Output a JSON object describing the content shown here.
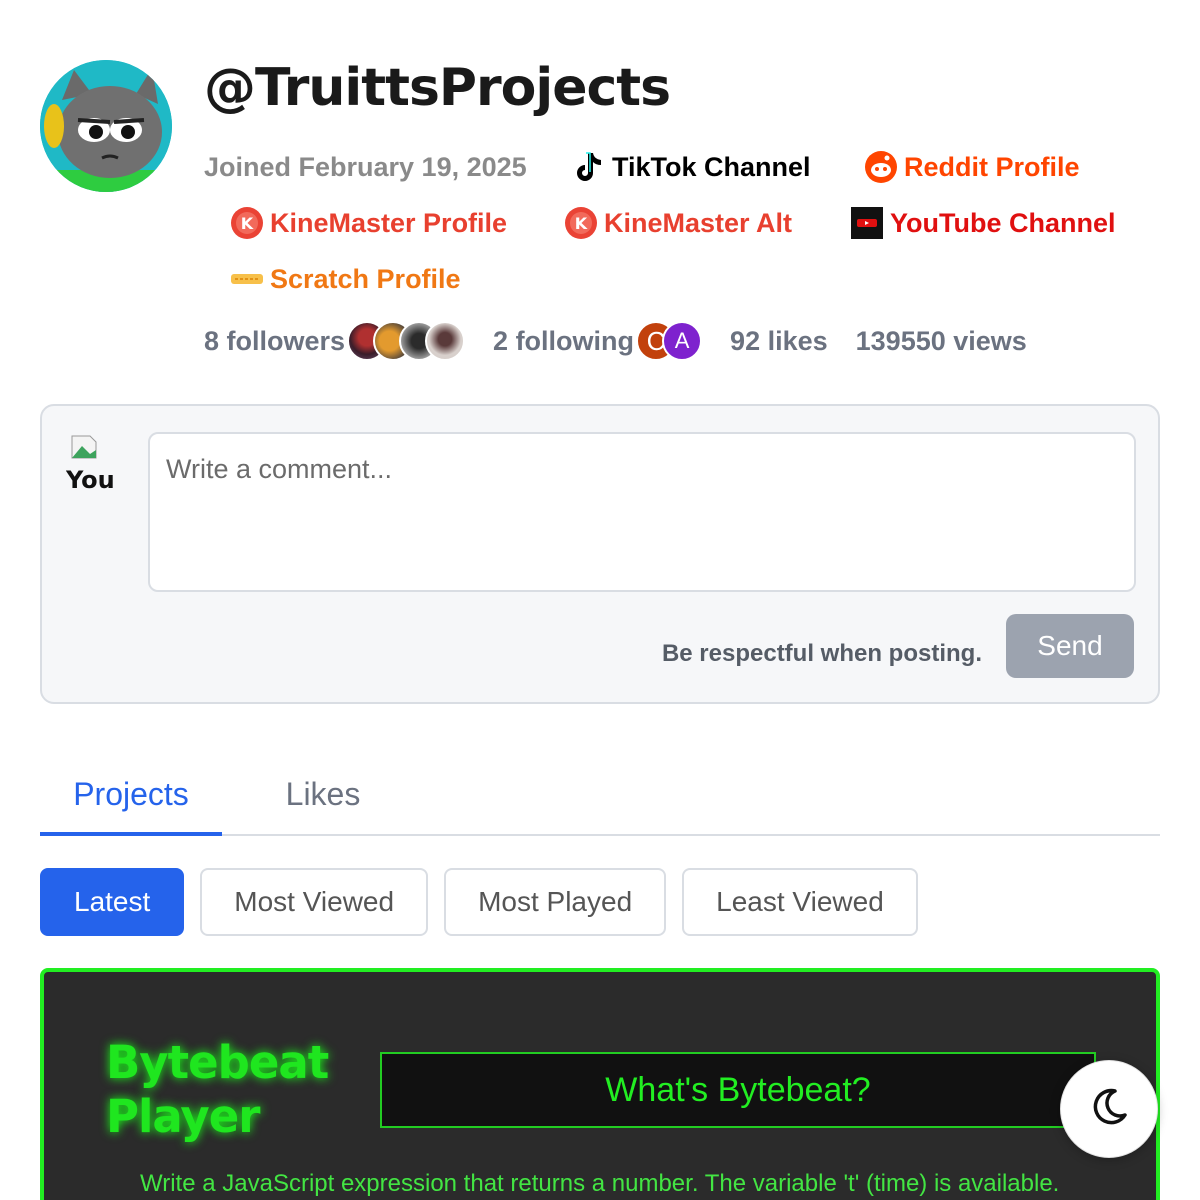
{
  "profile": {
    "username": "@TruittsProjects",
    "joined": "Joined February 19, 2025"
  },
  "links": {
    "tiktok": "TikTok Channel",
    "reddit": "Reddit Profile",
    "kinemaster": "KineMaster Profile",
    "kinemaster_alt": "KineMaster Alt",
    "youtube": "YouTube Channel",
    "scratch": "Scratch Profile"
  },
  "stats": {
    "followers": "8 followers",
    "following": "2 following",
    "likes": "92 likes",
    "views": "139550 views",
    "following_avatars": [
      "C",
      "A"
    ]
  },
  "comment": {
    "you_label": "You",
    "placeholder": "Write a comment...",
    "notice": "Be respectful when posting.",
    "send_label": "Send"
  },
  "tabs": [
    "Projects",
    "Likes"
  ],
  "filters": [
    "Latest",
    "Most Viewed",
    "Most Played",
    "Least Viewed"
  ],
  "project": {
    "title": "Bytebeat Player",
    "button": "What's Bytebeat?",
    "description": "Write a JavaScript expression that returns a number. The variable 't' (time) is available."
  },
  "colors": {
    "accent": "#2563eb",
    "reddit": "#ff4500",
    "kinemaster": "#e8402f",
    "youtube": "#e01010",
    "scratch": "#f07814",
    "project_green": "#22ee22"
  },
  "icons": {
    "theme_toggle": "moon-icon"
  }
}
